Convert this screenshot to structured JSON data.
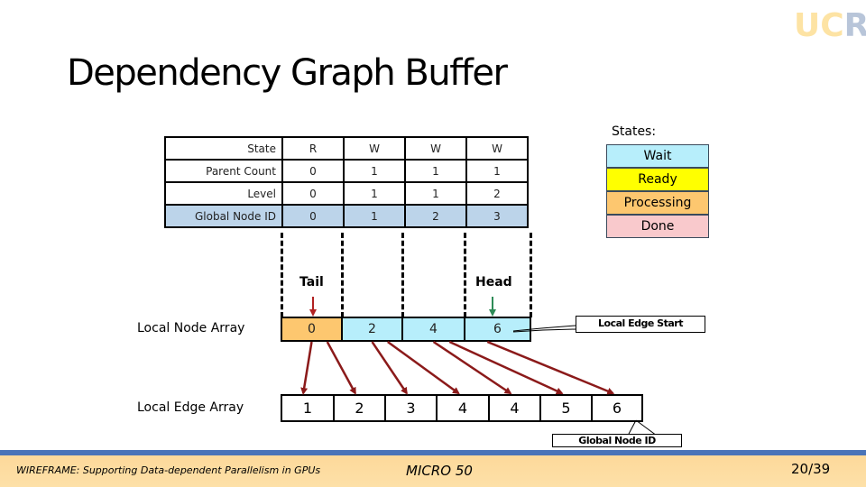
{
  "logo": {
    "letters": [
      "U",
      "C",
      "R"
    ]
  },
  "title": "Dependency Graph Buffer",
  "table": {
    "rows": [
      {
        "label": "State",
        "values": [
          "R",
          "W",
          "W",
          "W"
        ]
      },
      {
        "label": "Parent Count",
        "values": [
          "0",
          "1",
          "1",
          "1"
        ]
      },
      {
        "label": "Level",
        "values": [
          "0",
          "1",
          "1",
          "2"
        ]
      },
      {
        "label": "Global Node ID",
        "values": [
          "0",
          "1",
          "2",
          "3"
        ]
      }
    ]
  },
  "states_legend": {
    "label": "States:",
    "items": [
      {
        "name": "Wait",
        "color": "#b7eefb"
      },
      {
        "name": "Ready",
        "color": "#ffff00"
      },
      {
        "name": "Processing",
        "color": "#fdc76f"
      },
      {
        "name": "Done",
        "color": "#f9c9cc"
      }
    ]
  },
  "pointers": {
    "tail": "Tail",
    "head": "Head",
    "tail_color": "#b22222",
    "head_color": "#2e8b57"
  },
  "local_node_array": {
    "label": "Local Node Array",
    "values": [
      "0",
      "2",
      "4",
      "6"
    ],
    "states": [
      "Processing",
      "Wait",
      "Wait",
      "Wait"
    ]
  },
  "local_edge_array": {
    "label": "Local Edge Array",
    "values": [
      "1",
      "2",
      "3",
      "4",
      "4",
      "5",
      "6"
    ]
  },
  "callouts": {
    "local_edge_start": "Local Edge Start",
    "global_node_id": "Global Node ID"
  },
  "edges": [
    [
      0,
      0
    ],
    [
      0,
      1
    ],
    [
      1,
      2
    ],
    [
      1,
      3
    ],
    [
      2,
      4
    ],
    [
      2,
      5
    ],
    [
      3,
      6
    ]
  ],
  "arrow_color": "#8b1a1a",
  "footer": {
    "paper": "WIREFRAME: Supporting Data-dependent Parallelism in GPUs",
    "venue": "MICRO 50",
    "page": "20/39"
  }
}
